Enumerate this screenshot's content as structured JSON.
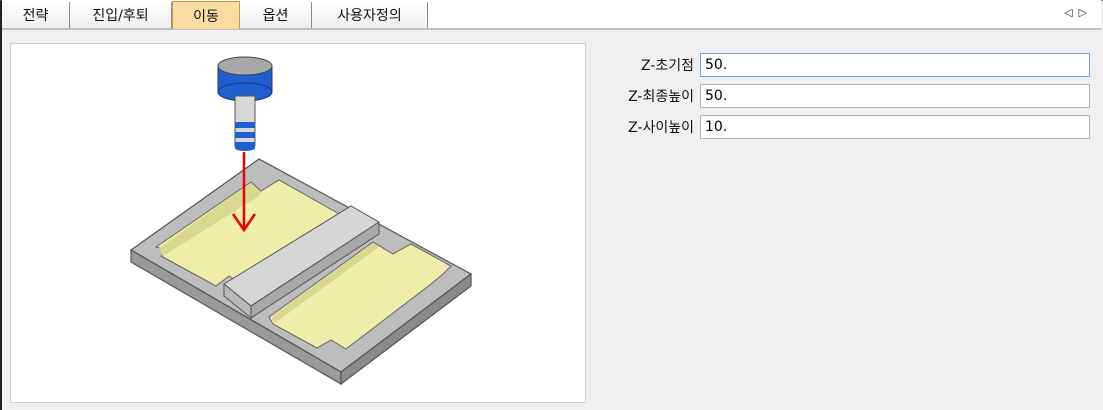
{
  "tabs": [
    {
      "label": "전략",
      "active": false
    },
    {
      "label": "진입/후퇴",
      "active": false
    },
    {
      "label": "이동",
      "active": true
    },
    {
      "label": "옵션",
      "active": false
    },
    {
      "label": "사용자정의",
      "active": false
    }
  ],
  "tab_scroll": {
    "left": "◁",
    "right": "▷"
  },
  "params": [
    {
      "label": "Z-초기점",
      "value": "50."
    },
    {
      "label": "Z-최종높이",
      "value": "50."
    },
    {
      "label": "Z-사이높이",
      "value": "10."
    }
  ],
  "colors": {
    "active_tab": "#fbdca0",
    "pocket_fill": "#eeeeaa",
    "arrow": "#ee0000",
    "tool_blue": "#1f5fd0"
  }
}
